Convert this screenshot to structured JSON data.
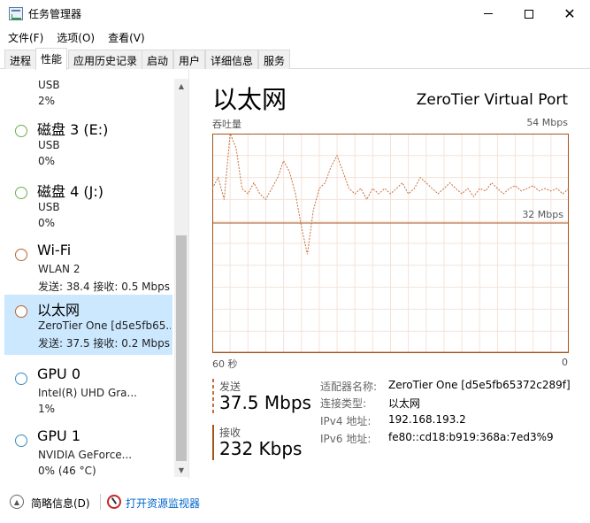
{
  "window": {
    "title": "任务管理器",
    "close_glyph": "✕"
  },
  "menu": [
    "文件(F)",
    "选项(O)",
    "查看(V)"
  ],
  "tabs": [
    "进程",
    "性能",
    "应用历史记录",
    "启动",
    "用户",
    "详细信息",
    "服务"
  ],
  "active_tab": "性能",
  "resources": [
    {
      "title": "",
      "sub": "USB",
      "val": "2%",
      "color": "#6ab04c",
      "partial": true
    },
    {
      "title": "磁盘 3 (E:)",
      "sub": "USB",
      "val": "0%",
      "color": "#6ab04c"
    },
    {
      "title": "磁盘 4 (J:)",
      "sub": "USB",
      "val": "0%",
      "color": "#6ab04c"
    },
    {
      "title": "Wi-Fi",
      "sub": "WLAN 2",
      "val": "发送: 38.4 接收: 0.5 Mbps",
      "color": "#b5652d"
    },
    {
      "title": "以太网",
      "sub": "ZeroTier One [d5e5fb65...",
      "val": "发送: 37.5 接收: 0.2 Mbps",
      "color": "#b5652d",
      "selected": true
    },
    {
      "title": "GPU 0",
      "sub": "Intel(R) UHD Gra...",
      "val": "1%",
      "color": "#3c8dbc"
    },
    {
      "title": "GPU 1",
      "sub": "NVIDIA GeForce...",
      "val": "0% (46 °C)",
      "color": "#3c8dbc"
    }
  ],
  "detail": {
    "title": "以太网",
    "adapter": "ZeroTier Virtual Port",
    "throughput_label": "吞吐量",
    "max_label": "54 Mbps",
    "mid_label": "32 Mbps",
    "x_left": "60 秒",
    "x_right": "0",
    "send_label": "发送",
    "send_value": "37.5 Mbps",
    "recv_label": "接收",
    "recv_value": "232 Kbps",
    "properties": [
      {
        "key": "适配器名称:",
        "value": "ZeroTier One [d5e5fb65372c289f]"
      },
      {
        "key": "连接类型:",
        "value": "以太网"
      },
      {
        "key": "IPv4 地址:",
        "value": "192.168.193.2"
      },
      {
        "key": "IPv6 地址:",
        "value": "fe80::cd18:b919:368a:7ed3%9"
      }
    ]
  },
  "chart_data": {
    "type": "line",
    "ylabel": "吞吐量",
    "ylim": [
      0,
      54
    ],
    "x_range_label": [
      "60 秒",
      "0"
    ],
    "reference_line": 32,
    "series": [
      {
        "values": [
          40.5,
          43.2,
          37.8,
          54.0,
          50.5,
          40.5,
          39.2,
          41.9,
          39.2,
          37.8,
          40.5,
          43.2,
          47.3,
          44.6,
          39.2,
          31.1,
          24.3,
          35.1,
          40.5,
          41.9,
          45.9,
          48.6,
          44.6,
          40.5,
          39.2,
          40.5,
          37.8,
          40.5,
          39.2,
          40.5,
          39.2,
          40.5,
          41.9,
          39.2,
          40.5,
          43.2,
          41.9,
          40.5,
          39.2,
          40.5,
          41.9,
          40.5,
          39.2,
          40.5,
          38.5,
          40.5,
          39.9,
          41.9,
          40.5,
          39.2,
          40.5,
          41.2,
          39.9,
          40.5,
          41.2,
          39.9,
          40.5,
          39.9,
          40.5,
          39.2,
          40.5
        ],
        "color": "#c86e3a",
        "dashed": true
      },
      {
        "values": [
          0.2,
          0.2,
          0.2,
          0.2,
          0.2,
          0.2,
          0.2,
          0.2,
          0.2,
          0.2,
          0.2,
          0.2,
          0.2,
          0.2,
          0.2,
          0.2,
          0.2,
          0.2,
          0.2,
          0.2,
          0.2,
          0.2,
          0.2,
          0.2,
          0.2,
          0.2,
          0.2,
          0.2,
          0.2,
          0.2,
          0.2,
          0.2,
          0.2,
          0.2,
          0.2,
          0.2,
          0.2,
          0.2,
          0.2,
          0.2,
          0.2,
          0.2,
          0.2,
          0.2,
          0.2,
          0.2,
          0.2,
          0.2,
          0.2,
          0.2,
          0.2,
          0.2,
          0.2,
          0.2,
          0.2,
          0.2,
          0.2,
          0.2,
          0.2,
          0.2,
          0.2
        ],
        "color": "#a7521a",
        "dashed": false
      }
    ],
    "grid": true
  },
  "footer": {
    "fewer_details": "简略信息(D)",
    "open_monitor": "打开资源监视器"
  },
  "colors": {
    "chart_border": "#a7521a",
    "grid": "#f3e3d8",
    "selected": "#cce8ff"
  }
}
